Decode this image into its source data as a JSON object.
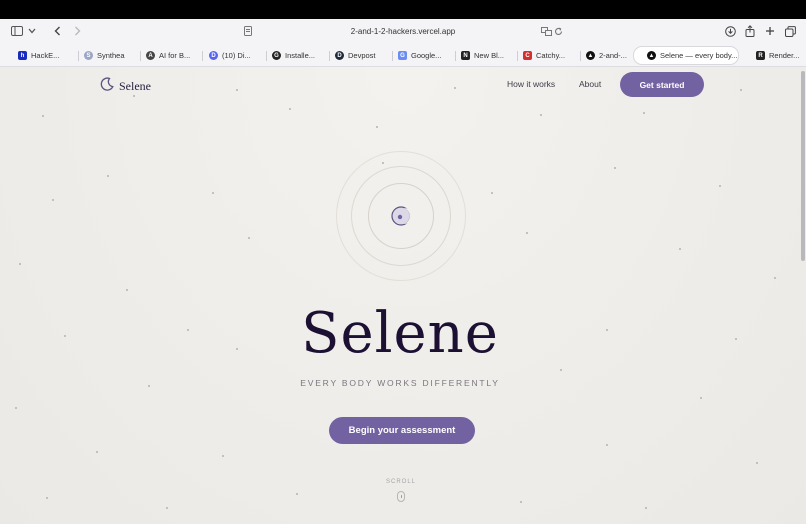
{
  "browser": {
    "url": "2-and-1-2-hackers.vercel.app",
    "tabs": [
      {
        "label": "HackE...",
        "icon": "h",
        "color": "#1a2bbf"
      },
      {
        "label": "Synthea",
        "icon": "S",
        "color": "#9aa6c4"
      },
      {
        "label": "AI for B...",
        "icon": "A",
        "color": "#444444"
      },
      {
        "label": "(10) Di...",
        "icon": "D",
        "color": "#5865f2"
      },
      {
        "label": "Installe...",
        "icon": "G",
        "color": "#222222"
      },
      {
        "label": "Devpost",
        "icon": "D",
        "color": "#1f2a3a"
      },
      {
        "label": "Google...",
        "icon": "G",
        "color": "#6b8cf0"
      },
      {
        "label": "New Bl...",
        "icon": "N",
        "color": "#222222"
      },
      {
        "label": "Catchy...",
        "icon": "C",
        "color": "#d32f2f"
      },
      {
        "label": "2-and-...",
        "icon": "▲",
        "color": "#111111"
      },
      {
        "label": "Selene — every body...",
        "icon": "▲",
        "color": "#111111"
      },
      {
        "label": "Render...",
        "icon": "R",
        "color": "#222222"
      }
    ]
  },
  "nav": {
    "logo_text": "Selene",
    "links": [
      "How it works",
      "About"
    ],
    "cta_label": "Get started"
  },
  "hero": {
    "title": "Selene",
    "subtitle": "EVERY BODY WORKS DIFFERENTLY",
    "button_label": "Begin your assessment",
    "scroll_label": "SCROLL"
  },
  "colors": {
    "accent": "#7362a2",
    "title": "#1c1033",
    "background": "#efede9"
  }
}
